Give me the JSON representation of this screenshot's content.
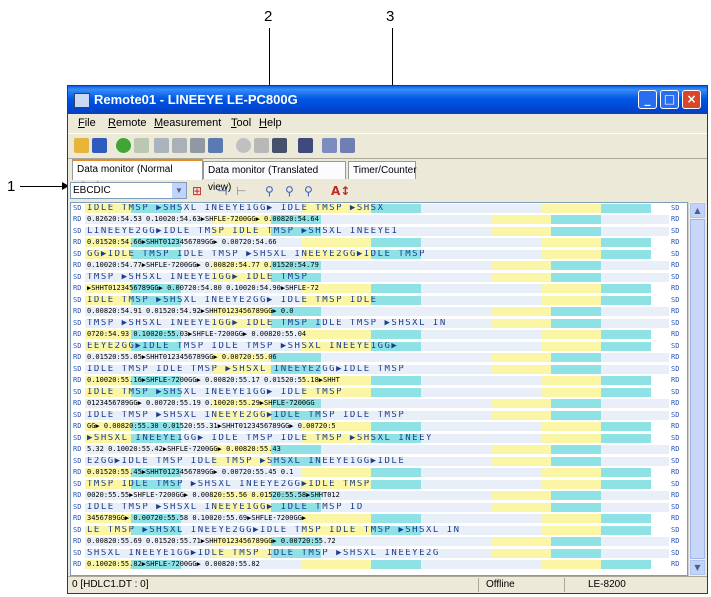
{
  "callouts": [
    "1",
    "2",
    "3"
  ],
  "window": {
    "title": "Remote01 - LINEEYE LE-PC800G",
    "min_label": "_",
    "max_label": "□",
    "close_label": "×"
  },
  "menu": [
    "File",
    "Remote",
    "Measurement",
    "Tool",
    "Help"
  ],
  "toolbar_icons": [
    "open-icon",
    "save-icon",
    "start-icon",
    "stop-icon",
    "print-icon",
    "copy-icon",
    "settings-icon",
    "monitor-icon",
    "record-icon",
    "pause-icon",
    "download-icon",
    "window-icon",
    "window2-icon",
    "cascade-icon"
  ],
  "tabs": [
    {
      "label": "Data monitor (Normal view)",
      "active": true
    },
    {
      "label": "Data monitor (Translated view)",
      "active": false
    },
    {
      "label": "Timer/Counter",
      "active": false
    }
  ],
  "filter": {
    "code_select": "EBCDIC",
    "select_arrow": "▼"
  },
  "filter_icons": [
    "font-icon",
    "split-icon",
    "merge-icon",
    "search-icon",
    "search-up-icon",
    "search-down-icon",
    "text-size-icon"
  ],
  "monitor": {
    "line_labels": [
      "SD",
      "RD"
    ],
    "idle": "IDLE",
    "tmsp": "TMSP",
    "rows": [
      {
        "sd": "IDLE  TMSP  ▶SHSXL INEEYE1GG▶ IDLE  TMSP  ▶SHSX",
        "rd": "0.82620:54.53   0.10020:54.63▶SHFLE-7200GG▶ 0.00820:54.64"
      },
      {
        "sd": "LINEEYE2GG▶IDLE  TMSP   IDLE TMSP ▶SHSXL INEEYE1",
        "rd": "0.01520:54.66▶SHHT0123456789GG▶ 0.00720:54.66"
      },
      {
        "sd": "GG▶IDLE  TMSP  IDLE TMSP ▶SHSXL INEEYE2GG▶IDLE TMSP",
        "rd": "0.10020:54.77▶SHFLE-7200GG▶ 0.00820:54.77   0.01520:54.79"
      },
      {
        "sd": "TMSP ▶SHSXL INEEYE1GG▶ IDLE TMSP",
        "rd": "▶SHHT0123456789GG▶ 0.00720:54.80   0.10020:54.90▶SHFLE-72"
      },
      {
        "sd": "IDLE TMSP ▶SHSXL INEEYE2GG▶ IDLE TMSP   IDLE",
        "rd": "0.00820:54.91   0.01520:54.92▶SHHT0123456789GG▶ 0.0"
      },
      {
        "sd": "TMSP ▶SHSXL INEEYE1GG▶ IDLE TMSP   IDLE TMSP ▶SHSXL IN",
        "rd": "0720:54.93   0.10020:55.03▶SHFLE-7200GG▶ 0.00820:55.04"
      },
      {
        "sd": "EEYE2GG▶IDLE TMSP   IDLE TMSP ▶SHSXL INEEYE1GG▶",
        "rd": "0.01520:55.05▶SHHT0123456789GG▶ 0.00720:55.06"
      },
      {
        "sd": "IDLE TMSP   IDLE TMSP ▶SHSXL INEEYE2GG▶IDLE TMSP",
        "rd": "0.10020:55.16▶SHFLE-7200GG▶ 0.00820:55.17   0.01520:55.18▶SHHT"
      },
      {
        "sd": "IDLE TMSP ▶SHSXL INEEYE1GG▶ IDLE TMSP",
        "rd": "0123456789GG▶ 0.00720:55.19   0.10020:55.29▶SHFLE-7200GG"
      },
      {
        "sd": "IDLE TMSP ▶SHSXL INEEYE2GG▶IDLE TMSP   IDLE TMSP",
        "rd": "GG▶ 0.00820:55.30   0.01520:55.31▶SHHT0123456789GG▶ 0.00720:5"
      },
      {
        "sd": "▶SHSXL INEEYE1GG▶ IDLE TMSP   IDLE TMSP ▶SHSXL INEEY",
        "rd": "5.32   0.10020:55.42▶SHFLE-7200GG▶ 0.00820:55.43"
      },
      {
        "sd": "E2GG▶IDLE TMSP   IDLE TMSP ▶SHSXL INEEYE1GG▶IDLE",
        "rd": "0.01520:55.45▶SHHT0123456789GG▶ 0.00720:55.45   0.1"
      },
      {
        "sd": "TMSP   IDLE TMSP ▶SHSXL INEEYE2GG▶IDLE TMSP",
        "rd": "0020:55.55▶SHFLE-7200GG▶ 0.00820:55.56   0.01520:55.58▶SHHT012"
      },
      {
        "sd": "IDLE TMSP ▶SHSXL INEEYE1GG▶ IDLE TMSP   ID",
        "rd": "3456789GG▶ 0.00720:55.58   0.10020:55.69▶SHFLE-7200GG▶"
      },
      {
        "sd": "LE TMSP ▶SHSXL INEEYE2GG▶IDLE TMSP   IDLE TMSP ▶SHSXL IN",
        "rd": "0.00820:55.69   0.01520:55.71▶SHHT0123456789GG▶ 0.00720:55.72"
      },
      {
        "sd": "SHSXL INEEYE1GG▶IDLE TMSP   IDLE TMSP ▶SHSXL INEEYE2G",
        "rd": "0.10020:55.82▶SHFLE-7200GG▶ 0.00820:55.82"
      }
    ]
  },
  "scroll": {
    "up": "▲",
    "down": "▼"
  },
  "status": {
    "position": "0 [HDLC1.DT : 0]",
    "connection": "Offline",
    "model": "LE-8200"
  },
  "colors": {
    "title_blue": "#0058e6",
    "idle_bg": "#fbf6a5",
    "tmsp_bg": "#8ee2e6",
    "frame_bg": "#e9eff8",
    "gg_bg": "#2d6f8a",
    "tab_accent": "#e68b2c"
  }
}
